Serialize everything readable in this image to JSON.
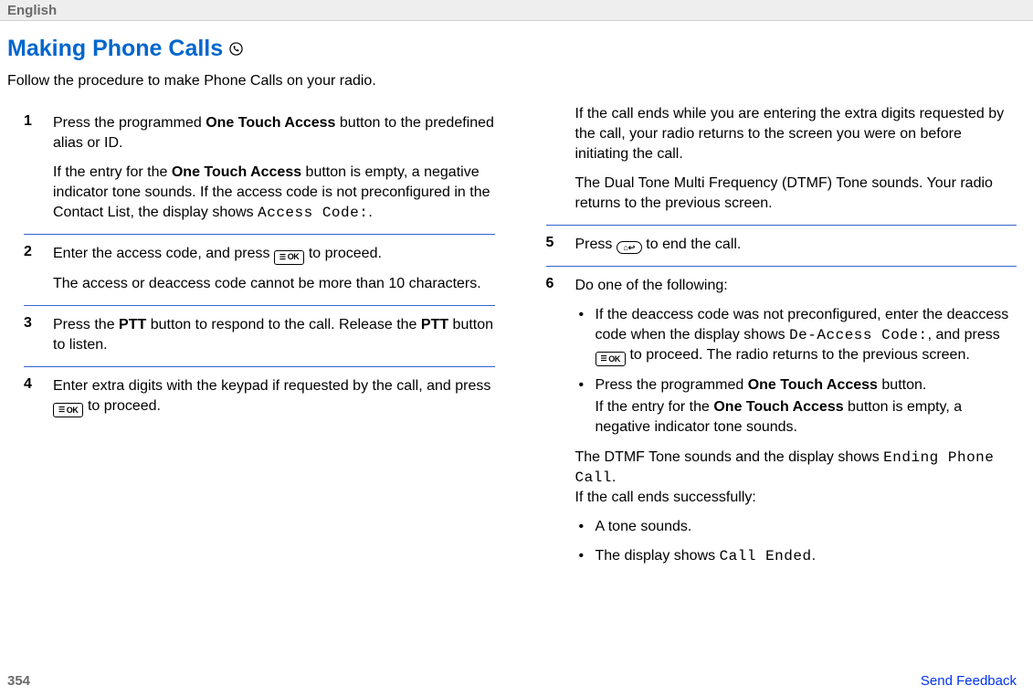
{
  "header": {
    "language": "English"
  },
  "title": "Making Phone Calls",
  "intro": "Follow the procedure to make Phone Calls on your radio.",
  "icons": {
    "ok_label": "OK",
    "back_label": "⌂↩"
  },
  "left": {
    "s1": {
      "num": "1",
      "p1a": "Press the programmed ",
      "p1b": "One Touch Access",
      "p1c": " button to the predefined alias or ID.",
      "p2a": "If the entry for the ",
      "p2b": "One Touch Access",
      "p2c": " button is empty, a negative indicator tone sounds. If the access code is not preconfigured in the Contact List, the display shows ",
      "p2d": "Access Code:",
      "p2e": "."
    },
    "s2": {
      "num": "2",
      "p1a": "Enter the access code, and press ",
      "p1b": " to proceed.",
      "p2": "The access or deaccess code cannot be more than 10 characters."
    },
    "s3": {
      "num": "3",
      "p1a": "Press the ",
      "p1b": "PTT",
      "p1c": " button to respond to the call. Release the ",
      "p1d": "PTT",
      "p1e": " button to listen."
    },
    "s4": {
      "num": "4",
      "p1a": "Enter extra digits with the keypad if requested by the call, and press ",
      "p1b": " to proceed."
    }
  },
  "right": {
    "cont": {
      "p1": "If the call ends while you are entering the extra digits requested by the call, your radio returns to the screen you were on before initiating the call.",
      "p2": "The Dual Tone Multi Frequency (DTMF) Tone sounds. Your radio returns to the previous screen."
    },
    "s5": {
      "num": "5",
      "p1a": "Press ",
      "p1b": " to end the call."
    },
    "s6": {
      "num": "6",
      "lead": "Do one of the following:",
      "b1a": "If the deaccess code was not preconfigured, enter the deaccess code when the display shows ",
      "b1b": "De-Access Code:",
      "b1c": ", and press ",
      "b1d": " to proceed. The radio returns to the previous screen.",
      "b2a": "Press the programmed ",
      "b2b": "One Touch Access",
      "b2c": " button.",
      "b2d": "If the entry for the ",
      "b2e": "One Touch Access",
      "b2f": " button is empty, a negative indicator tone sounds.",
      "after1a": "The DTMF Tone sounds and the display shows ",
      "after1b": "Ending Phone Call",
      "after1c": ".",
      "after2": "If the call ends successfully:",
      "b3": "A tone sounds.",
      "b4a": "The display shows ",
      "b4b": "Call Ended",
      "b4c": "."
    }
  },
  "footer": {
    "page_num": "354",
    "feedback": "Send Feedback"
  }
}
